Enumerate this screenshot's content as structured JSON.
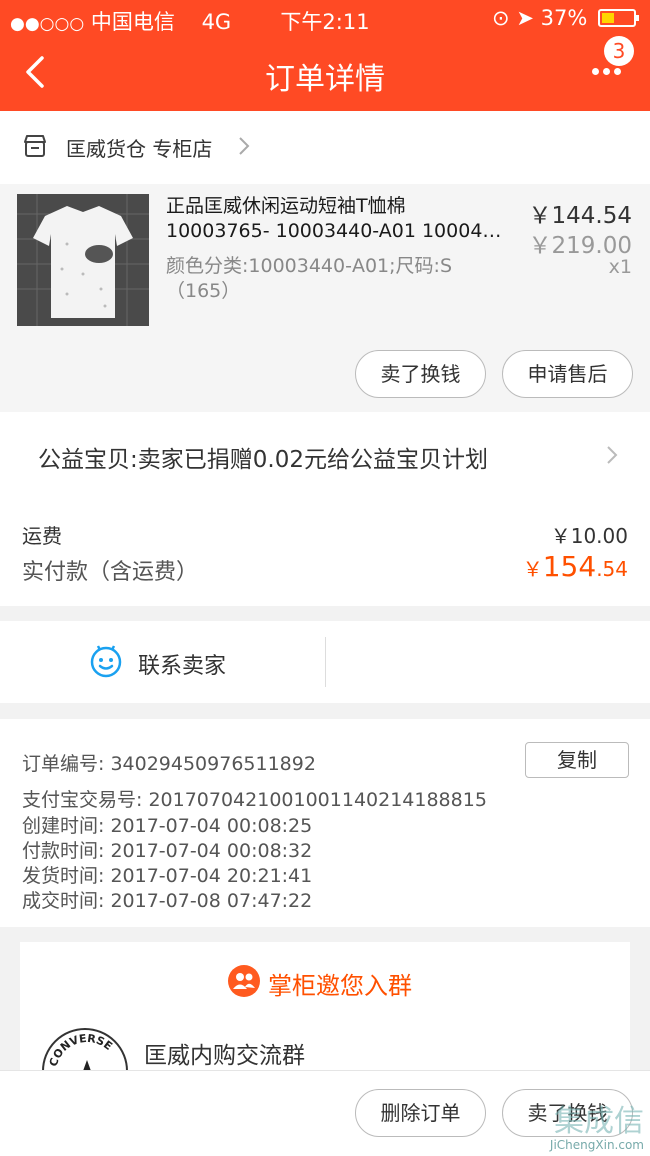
{
  "status_bar": {
    "carrier": "中国电信",
    "network": "4G",
    "time": "下午2:11",
    "battery": "37%"
  },
  "nav": {
    "title": "订单详情",
    "badge_count": "3",
    "back_icon": "chevron-left-icon",
    "more_icon": "more-dots-icon"
  },
  "shop": {
    "name": "匡威货仓 专柜店"
  },
  "product": {
    "title_line1": "正品匡威休闲运动短袖T恤棉",
    "title_line2": "10003765- 10003440-A01 10004…",
    "sku": "颜色分类:10003440-A01;尺码:S（165）",
    "price": "￥144.54",
    "original_price": "￥219.00",
    "quantity": "x1",
    "btn_sell": "卖了换钱",
    "btn_after_sale": "申请售后"
  },
  "charity": {
    "text": "公益宝贝:卖家已捐赠0.02元给公益宝贝计划"
  },
  "payment": {
    "shipping_label": "运费",
    "shipping_value": "￥10.00",
    "paid_label": "实付款（含运费）",
    "paid_symbol": "￥",
    "paid_int": "154",
    "paid_dec": ".54"
  },
  "contact": {
    "label": "联系卖家"
  },
  "order_info": {
    "order_no": "订单编号:  34029450976511892",
    "copy_label": "复制",
    "alipay_no": "支付宝交易号:  2017070421001001140214188815",
    "created": "创建时间:  2017-07-04 00:08:25",
    "paid": "付款时间:  2017-07-04 00:08:32",
    "shipped": "发货时间:  2017-07-04 20:21:41",
    "completed": "成交时间:  2017-07-08 07:47:22"
  },
  "group": {
    "title": "掌柜邀您入群",
    "name": "匡威内购交流群",
    "logo_text": "CONVERSE"
  },
  "bottom": {
    "btn_delete": "删除订单",
    "btn_sell": "卖了换钱"
  },
  "watermark": {
    "big": "集成信",
    "small": "JiChengXin.com"
  },
  "colors": {
    "brand": "#ff4a24",
    "price_accent": "#ff5000"
  }
}
